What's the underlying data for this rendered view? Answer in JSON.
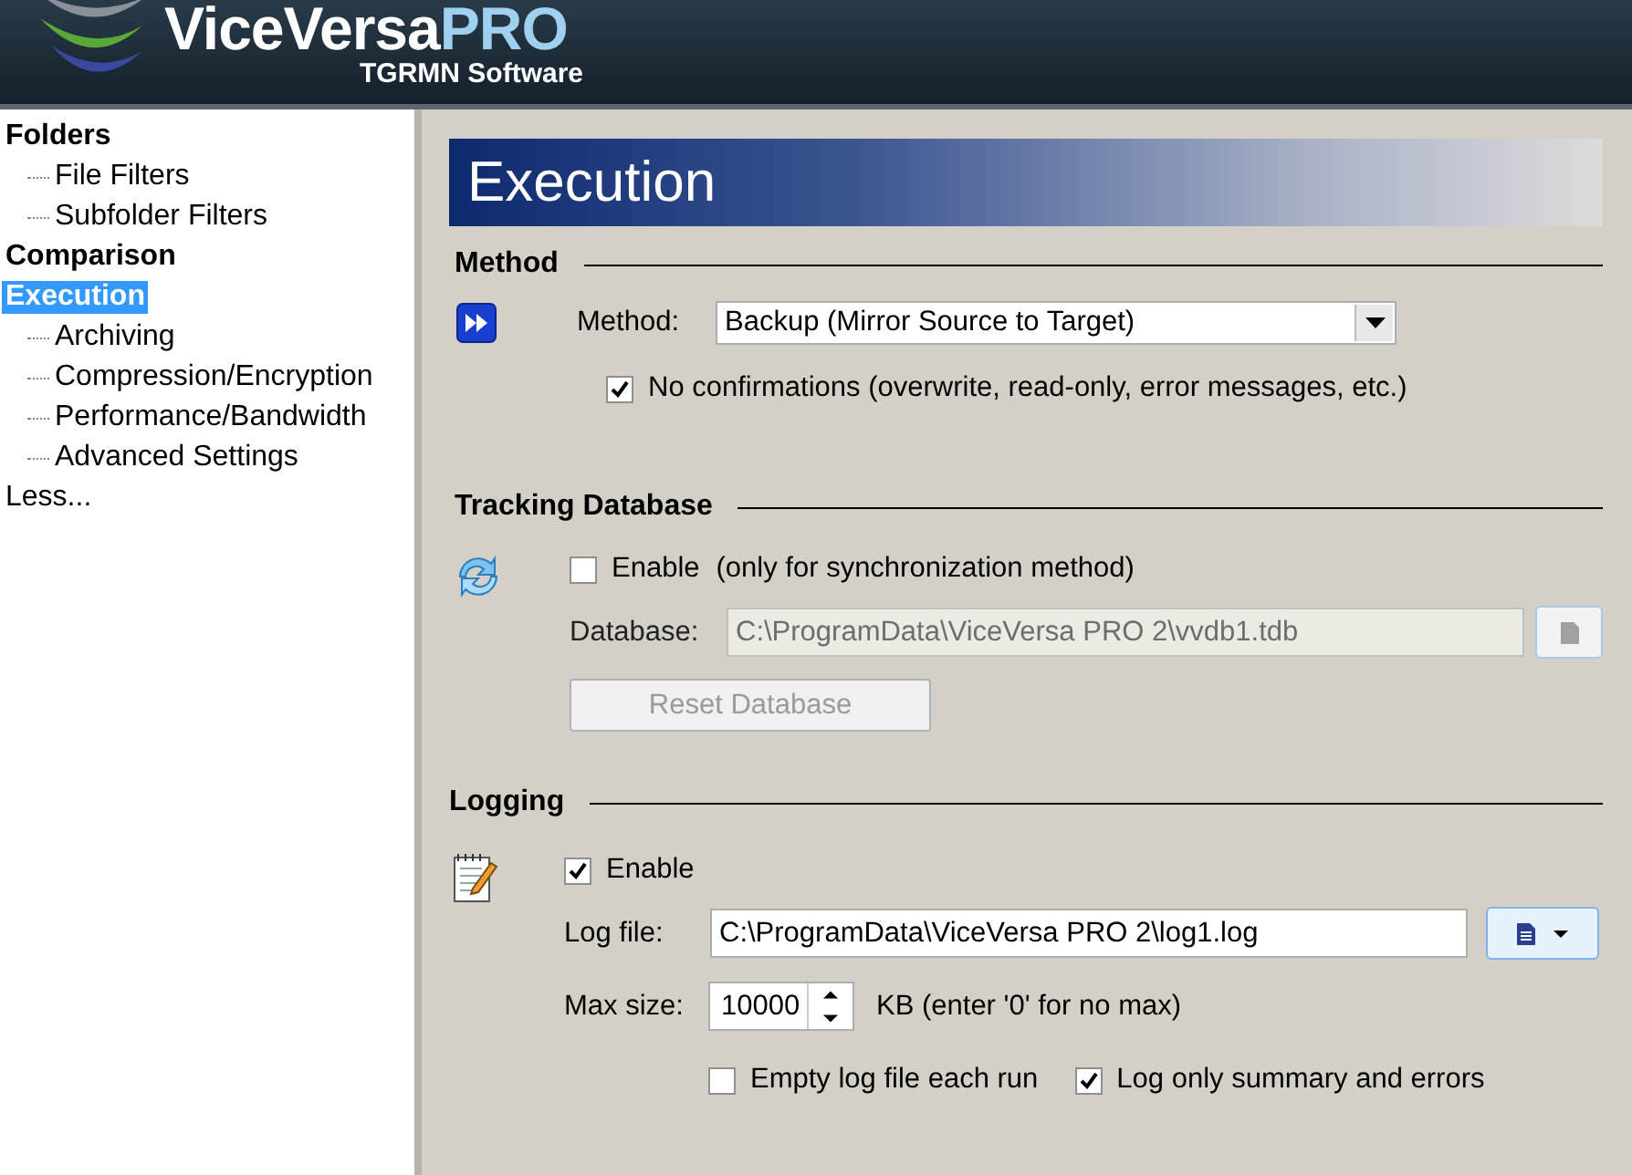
{
  "header": {
    "brand": "ViceVersa",
    "brand_suffix": "PRO",
    "company": "TGRMN Software"
  },
  "sidebar": {
    "items": [
      {
        "label": "Folders",
        "kind": "heading",
        "selected": false,
        "children": [
          {
            "label": "File Filters",
            "selected": false
          },
          {
            "label": "Subfolder Filters",
            "selected": false
          }
        ]
      },
      {
        "label": "Comparison",
        "kind": "heading",
        "selected": false
      },
      {
        "label": "Execution",
        "kind": "heading",
        "selected": true,
        "children": [
          {
            "label": "Archiving",
            "selected": false
          },
          {
            "label": "Compression/Encryption",
            "selected": false
          },
          {
            "label": "Performance/Bandwidth",
            "selected": false
          },
          {
            "label": "Advanced Settings",
            "selected": false
          }
        ]
      },
      {
        "label": "Less...",
        "kind": "plain",
        "selected": false
      }
    ]
  },
  "page_title": "Execution",
  "method": {
    "heading": "Method",
    "label": "Method:",
    "value": "Backup (Mirror Source to Target)",
    "no_confirm": {
      "label": "No confirmations (overwrite, read-only, error messages, etc.)",
      "checked": true
    }
  },
  "tracking": {
    "heading": "Tracking Database",
    "enable": {
      "label": "Enable",
      "checked": false
    },
    "note": "(only for synchronization method)",
    "database_label": "Database:",
    "database_value": "C:\\ProgramData\\ViceVersa PRO 2\\vvdb1.tdb",
    "disabled": true,
    "reset_button": "Reset Database"
  },
  "logging": {
    "heading": "Logging",
    "enable": {
      "label": "Enable",
      "checked": true
    },
    "log_file_label": "Log file:",
    "log_file_value": "C:\\ProgramData\\ViceVersa PRO 2\\log1.log",
    "max_size_label": "Max size:",
    "max_size_value": "10000",
    "max_size_note": "KB (enter '0' for no max)",
    "options": [
      {
        "label": "Empty log file each run",
        "checked": false
      },
      {
        "label": "Log only summary and errors",
        "checked": true
      }
    ]
  }
}
